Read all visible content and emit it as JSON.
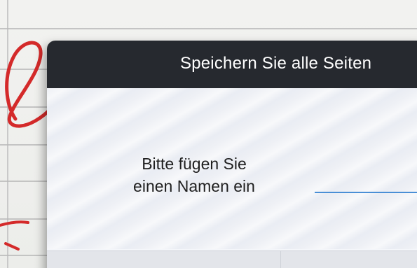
{
  "dialog": {
    "title": "Speichern Sie alle Seiten",
    "name_prompt_line1": "Bitte fügen Sie",
    "name_prompt_line2": "einen Namen ein",
    "name_input_value": ""
  },
  "colors": {
    "header_background": "#26292f",
    "header_text": "#ffffff",
    "input_underline": "#4a8fd6",
    "handwriting_ink": "#d42a2a"
  }
}
